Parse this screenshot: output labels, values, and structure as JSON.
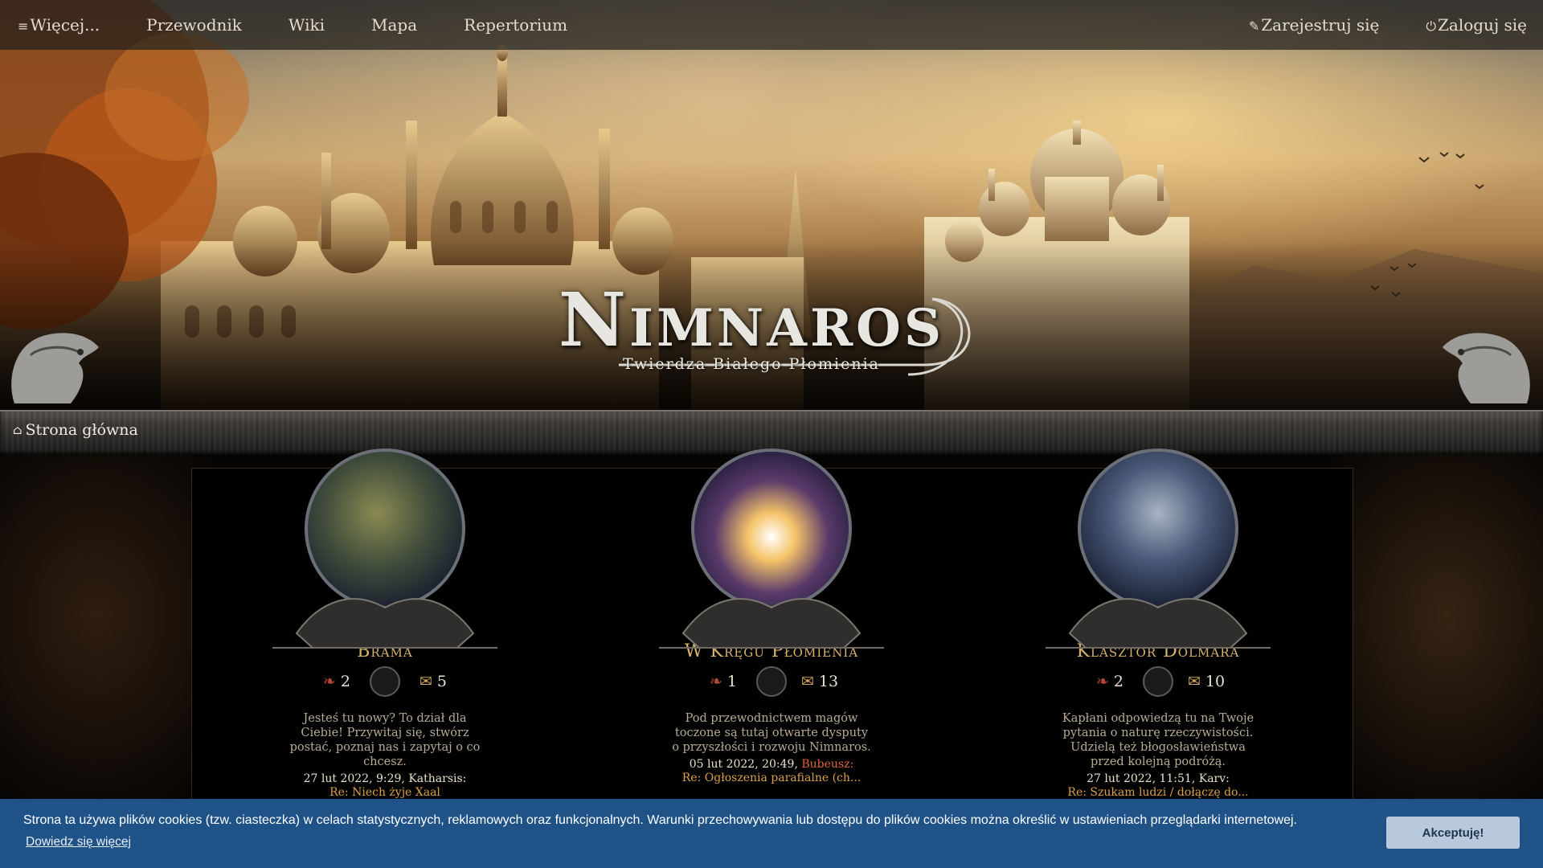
{
  "nav": {
    "more_label": "Więcej...",
    "items": [
      "Przewodnik",
      "Wiki",
      "Mapa",
      "Repertorium"
    ],
    "register_label": "Zarejestruj się",
    "login_label": "Zaloguj się"
  },
  "banner": {
    "logo_title": "Nimnaros",
    "logo_subtitle": "Twierdza Białego Płomienia"
  },
  "breadcrumb": {
    "home_label": "Strona główna"
  },
  "forums": [
    {
      "name": "Brama",
      "topics": "2",
      "posts": "5",
      "description": "Jesteś tu nowy? To dział dla Ciebie! Przywitaj się, stwórz postać, poznaj nas i zapytaj o co chcesz.",
      "last_date": "27 lut 2022, 9:29,",
      "last_author": "Katharsis:",
      "last_topic": "Re: Niech żyje Xaal"
    },
    {
      "name": "W Kręgu Płomienia",
      "topics": "1",
      "posts": "13",
      "description": "Pod przewodnictwem magów toczone są tutaj otwarte dysputy o przyszłości i rozwoju Nimnaros.",
      "last_date": "05 lut 2022, 20:49,",
      "last_author": "Bubeusz:",
      "last_topic": "Re: Ogłoszenia parafialne (ch..."
    },
    {
      "name": "Klasztor Dolmara",
      "topics": "2",
      "posts": "10",
      "description": "Kapłani odpowiedzą tu na Twoje pytania o naturę rzeczywistości. Udzielą też błogosławieństwa przed kolejną podróżą.",
      "last_date": "27 lut 2022, 11:51,",
      "last_author": "Karv:",
      "last_topic": "Re: Szukam ludzi / dołączę do..."
    }
  ],
  "cookie": {
    "message": "Strona ta używa plików cookies (tzw. ciasteczka) w celach statystycznych, reklamowych oraz funkcjonalnych. Warunki przechowywania lub dostępu do plików cookies można określić w ustawieniach przeglądarki internetowej.",
    "more_label": "Dowiedz się więcej",
    "accept_label": "Akceptuję!"
  },
  "colors": {
    "accent_gold": "#d9b36a",
    "author_red": "#e0663a",
    "cookie_bg": "#1f5287",
    "accept_bg": "#b9c9dd"
  },
  "icons": {
    "menu": "hamburger-icon",
    "register": "edit-icon",
    "login": "power-icon",
    "home": "home-icon",
    "topics": "book-icon",
    "posts": "scroll-icon"
  }
}
